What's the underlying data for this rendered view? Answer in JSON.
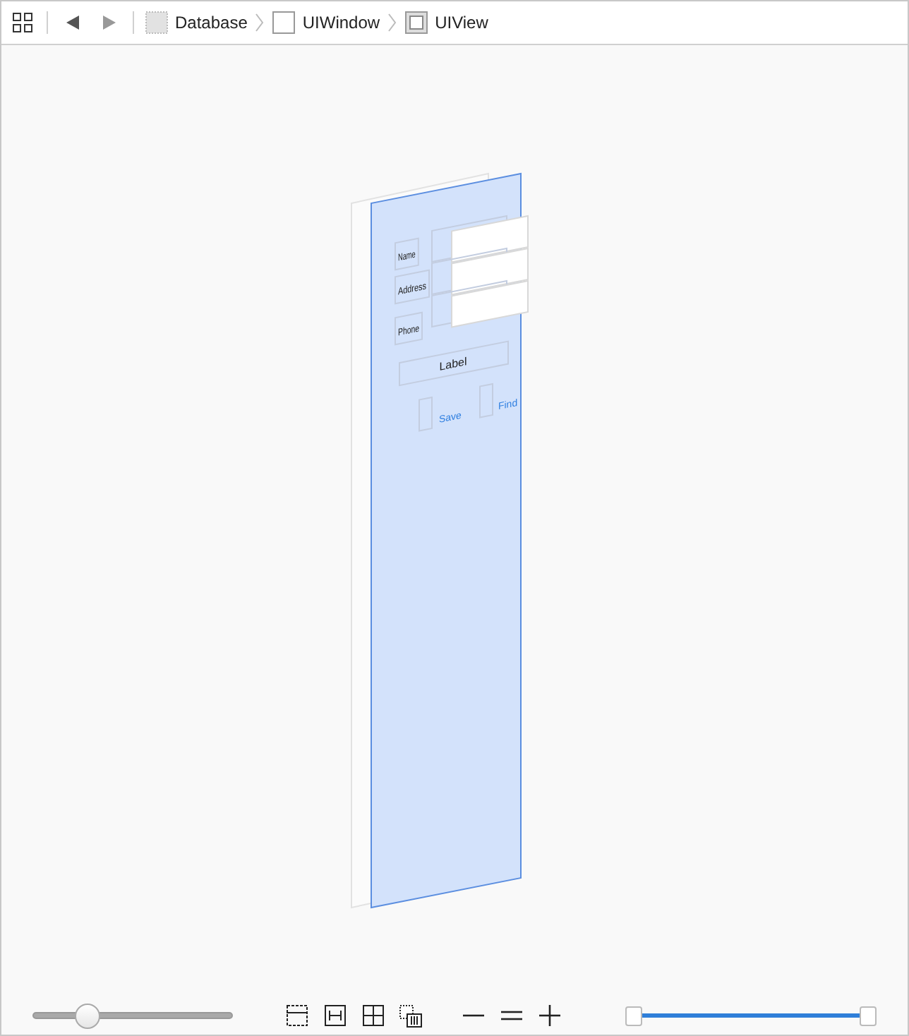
{
  "toolbar": {
    "breadcrumbs": [
      {
        "label": "Database",
        "kind": "database"
      },
      {
        "label": "UIWindow",
        "kind": "window"
      },
      {
        "label": "UIView",
        "kind": "view"
      }
    ]
  },
  "canvas": {
    "form_labels": [
      "Name",
      "Address",
      "Phone"
    ],
    "label_text": "Label",
    "buttons": [
      "Save",
      "Find"
    ]
  },
  "bottom_bar": {
    "spacing_slider": {
      "level": 0.24
    },
    "range_slider": {
      "thumbs": [
        {
          "level": 0
        },
        {
          "level": 1
        }
      ]
    }
  }
}
